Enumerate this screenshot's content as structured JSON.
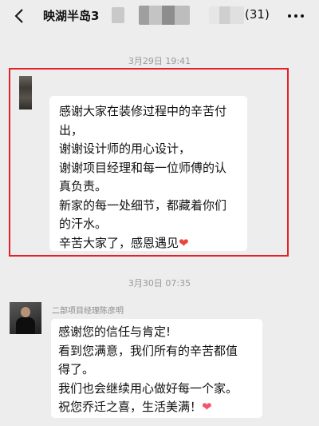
{
  "header": {
    "title": "映湖半岛3",
    "member_count": "(31)",
    "back_icon": "chevron-left-icon",
    "more_icon": "ellipsis-icon"
  },
  "messages": [
    {
      "timestamp": "3月29日 19:41",
      "sender": "",
      "lines": [
        "感谢大家在装修过程中的辛苦付",
        "出，",
        "谢谢设计师的用心设计，",
        "谢谢项目经理和每一位师傅的认",
        "真负责。",
        "新家的每一处细节，都藏着你们",
        "的汗水。",
        "辛苦大家了，感恩遇见"
      ],
      "emoji": "❤"
    },
    {
      "timestamp": "3月30日 07:35",
      "sender": "二部项目经理陈彦明",
      "lines": [
        "感谢您的信任与肯定!",
        "看到您满意，我们所有的辛苦都值",
        "得了。",
        "我们也会继续用心做好每一个家。",
        "祝您乔迁之喜，生活美满！"
      ],
      "emoji": "❤"
    }
  ],
  "colors": {
    "background": "#ededed",
    "bubble": "#ffffff",
    "highlight_border": "#e5202a",
    "heart_red": "#e8453c",
    "heart_pink": "#f2556a"
  }
}
